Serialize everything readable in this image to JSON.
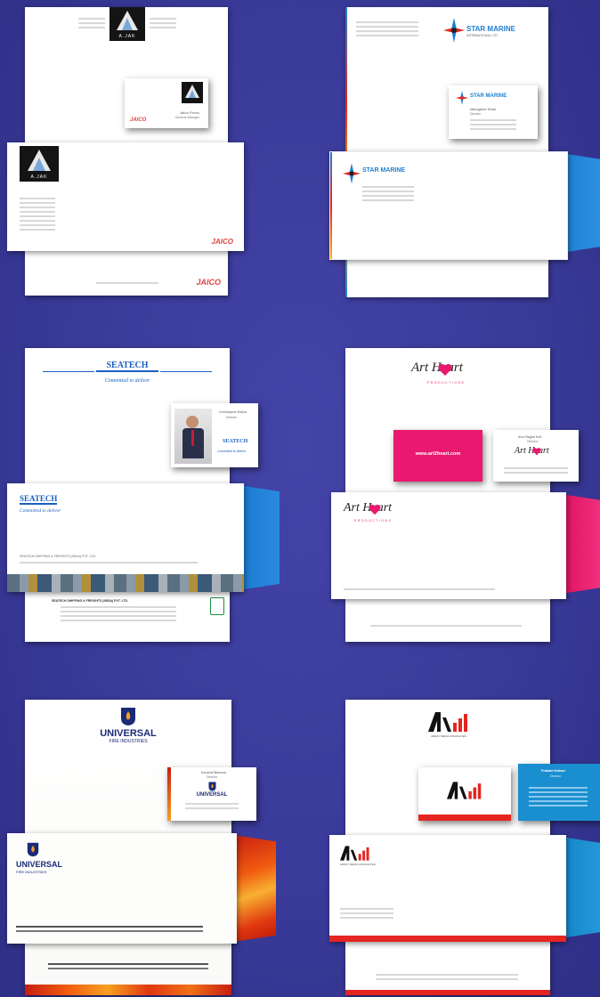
{
  "sets": [
    {
      "id": "ajak",
      "brand_name": "A.JAK",
      "partner_logo": "JAICO",
      "card_name": "Jaico Press",
      "card_title": "General Manager"
    },
    {
      "id": "star-marine",
      "brand_name": "STAR MARINE",
      "brand_tagline": "INTERNATIONAL LTD",
      "card_name": "Navigator Shah",
      "card_title": "Director"
    },
    {
      "id": "seatech",
      "brand_name": "SEATECH",
      "tagline": "Committed to deliver",
      "card_name": "Christopher Dsilva",
      "card_title": "Director",
      "footer_company": "SEATECH SHIPPING & FREIGHTS (INDIA) PVT. LTD."
    },
    {
      "id": "art-heart",
      "brand_name": "Art Heart",
      "brand_sub": "PRODUCTIONS",
      "website": "www.art2heart.com",
      "card_name": "Alex Rajpal Kelt",
      "card_title": "Director"
    },
    {
      "id": "universal",
      "brand_name": "UNIVERSAL",
      "brand_sub": "FIRE INDUSTRIES",
      "card_name": "Kaushal Bhavsar",
      "card_title": "Director"
    },
    {
      "id": "ama",
      "brand_sub": "ARRAY MEDIA ASSOCIATES",
      "card_name": "Prakash Kothari",
      "card_title": "Director"
    }
  ],
  "colors": {
    "background": "#3a3a9a",
    "star_blue": "#1e7fd0",
    "art_pink": "#e8196e",
    "seatech_blue": "#1a5fc0",
    "universal_navy": "#1a2a78",
    "ama_red": "#e52521",
    "ama_blue": "#1a8fd0"
  }
}
